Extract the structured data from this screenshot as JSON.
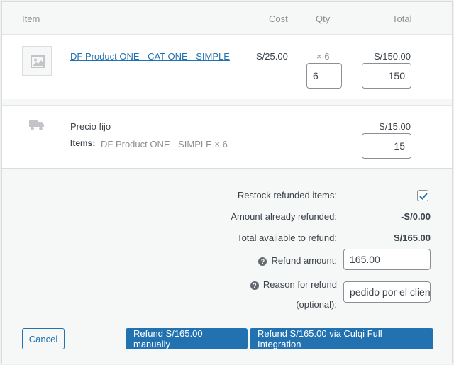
{
  "table": {
    "headers": {
      "item": "Item",
      "cost": "Cost",
      "qty": "Qty",
      "total": "Total"
    }
  },
  "line_item": {
    "name": "DF Product ONE - CAT ONE - SIMPLE",
    "cost": "S/25.00",
    "qty_label": "× 6",
    "total": "S/150.00",
    "refund_qty": "6",
    "refund_total": "150"
  },
  "shipping": {
    "name": "Precio fijo",
    "items_label": "Items:",
    "items_value": "DF Product ONE - SIMPLE × 6",
    "total": "S/15.00",
    "refund_total": "15"
  },
  "refund": {
    "restock_label": "Restock refunded items:",
    "restock_checked": true,
    "already_refunded_label": "Amount already refunded:",
    "already_refunded_value": "-S/0.00",
    "available_label": "Total available to refund:",
    "available_value": "S/165.00",
    "amount_label": "Refund amount:",
    "amount_value": "165.00",
    "reason_label_1": "Reason for refund",
    "reason_label_2": "(optional):",
    "reason_value": "pedido por el cliente"
  },
  "buttons": {
    "cancel": "Cancel",
    "manual": "Refund S/165.00 manually",
    "gateway": "Refund S/165.00 via Culqi Full Integration"
  },
  "colors": {
    "accent": "#2271b1",
    "background": "#f6f7f7",
    "border": "#dcdcde"
  }
}
